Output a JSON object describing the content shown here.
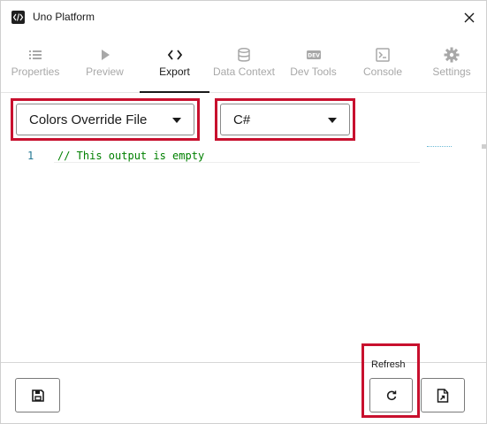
{
  "window": {
    "title": "Uno Platform",
    "close_icon": "close-icon",
    "app_icon": "code-icon"
  },
  "tabs": [
    {
      "label": "Properties",
      "icon": "list-icon",
      "active": false
    },
    {
      "label": "Preview",
      "icon": "play-icon",
      "active": false
    },
    {
      "label": "Export",
      "icon": "code-icon",
      "active": true
    },
    {
      "label": "Data Context",
      "icon": "database-icon",
      "active": false
    },
    {
      "label": "Dev Tools",
      "icon": "dev-icon",
      "active": false
    },
    {
      "label": "Console",
      "icon": "terminal-icon",
      "active": false
    },
    {
      "label": "Settings",
      "icon": "gear-icon",
      "active": false
    }
  ],
  "export": {
    "file_type_selected": "Colors Override File",
    "language_selected": "C#"
  },
  "editor": {
    "line_number": "1",
    "code": "// This output is empty"
  },
  "footer": {
    "refresh_tooltip": "Refresh",
    "save_icon": "save-icon",
    "refresh_icon": "refresh-icon",
    "export_file_icon": "file-export-icon"
  },
  "colors": {
    "highlight": "#c8102e",
    "comment": "#008000",
    "line_number": "#237893"
  }
}
